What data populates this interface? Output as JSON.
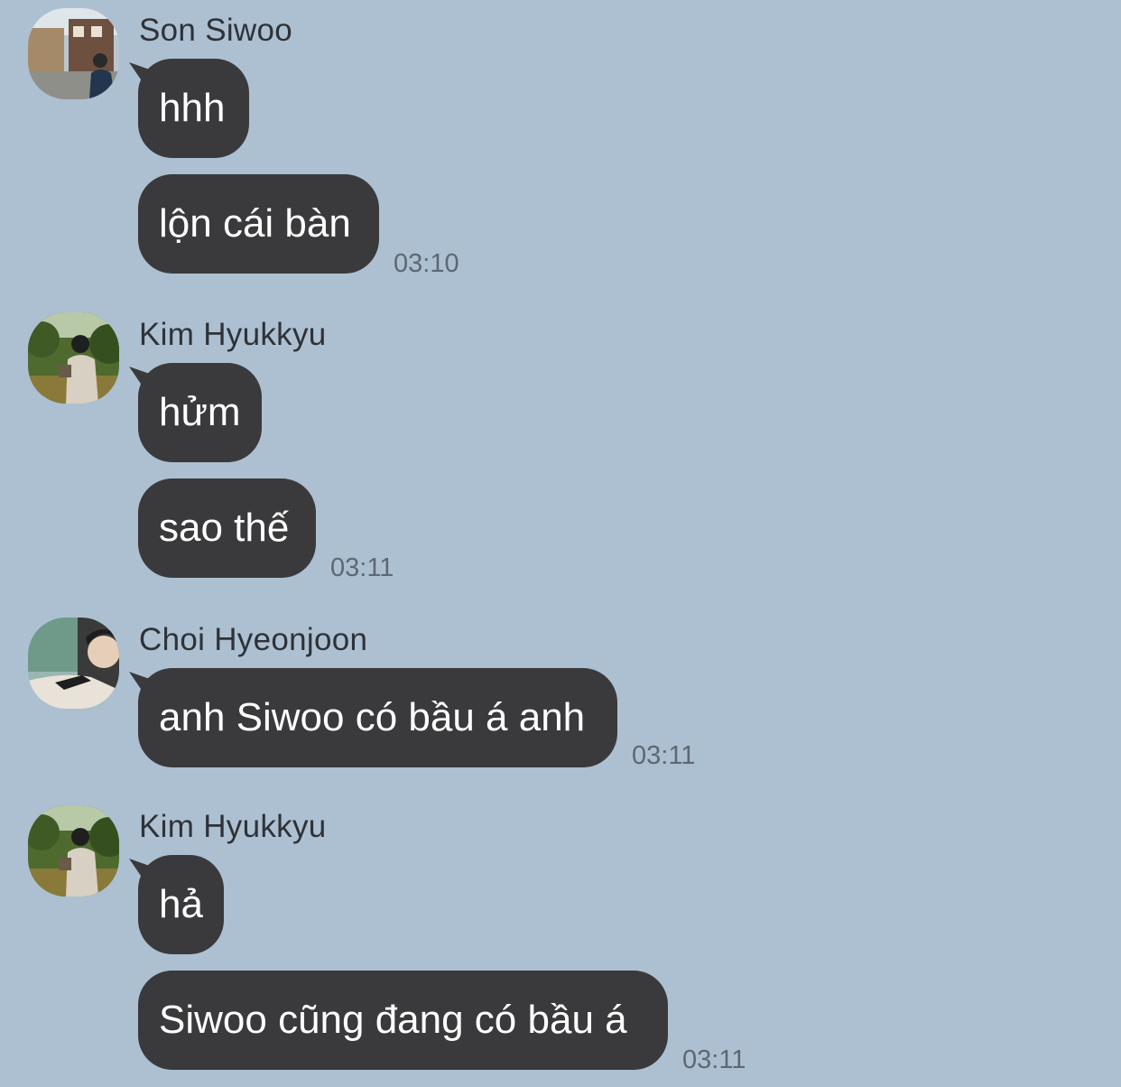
{
  "groups": [
    {
      "sender": "Son Siwoo",
      "avatar_icon": "profile-photo-street",
      "messages": [
        "hhh",
        "lộn cái bàn"
      ],
      "time": "03:10"
    },
    {
      "sender": "Kim Hyukkyu",
      "avatar_icon": "profile-photo-park",
      "messages": [
        "hửm",
        "sao thế"
      ],
      "time": "03:11"
    },
    {
      "sender": "Choi Hyeonjoon",
      "avatar_icon": "profile-photo-selfie",
      "messages": [
        "anh Siwoo có bầu á anh"
      ],
      "time": "03:11"
    },
    {
      "sender": "Kim Hyukkyu",
      "avatar_icon": "profile-photo-park",
      "messages": [
        "hả",
        "Siwoo cũng đang có bầu á"
      ],
      "time": "03:11"
    }
  ],
  "colors": {
    "background": "#adc0d1",
    "bubble": "#3a3a3c",
    "bubble_text": "#ffffff",
    "sender_text": "#2e3238",
    "time_text": "#5d6873"
  }
}
